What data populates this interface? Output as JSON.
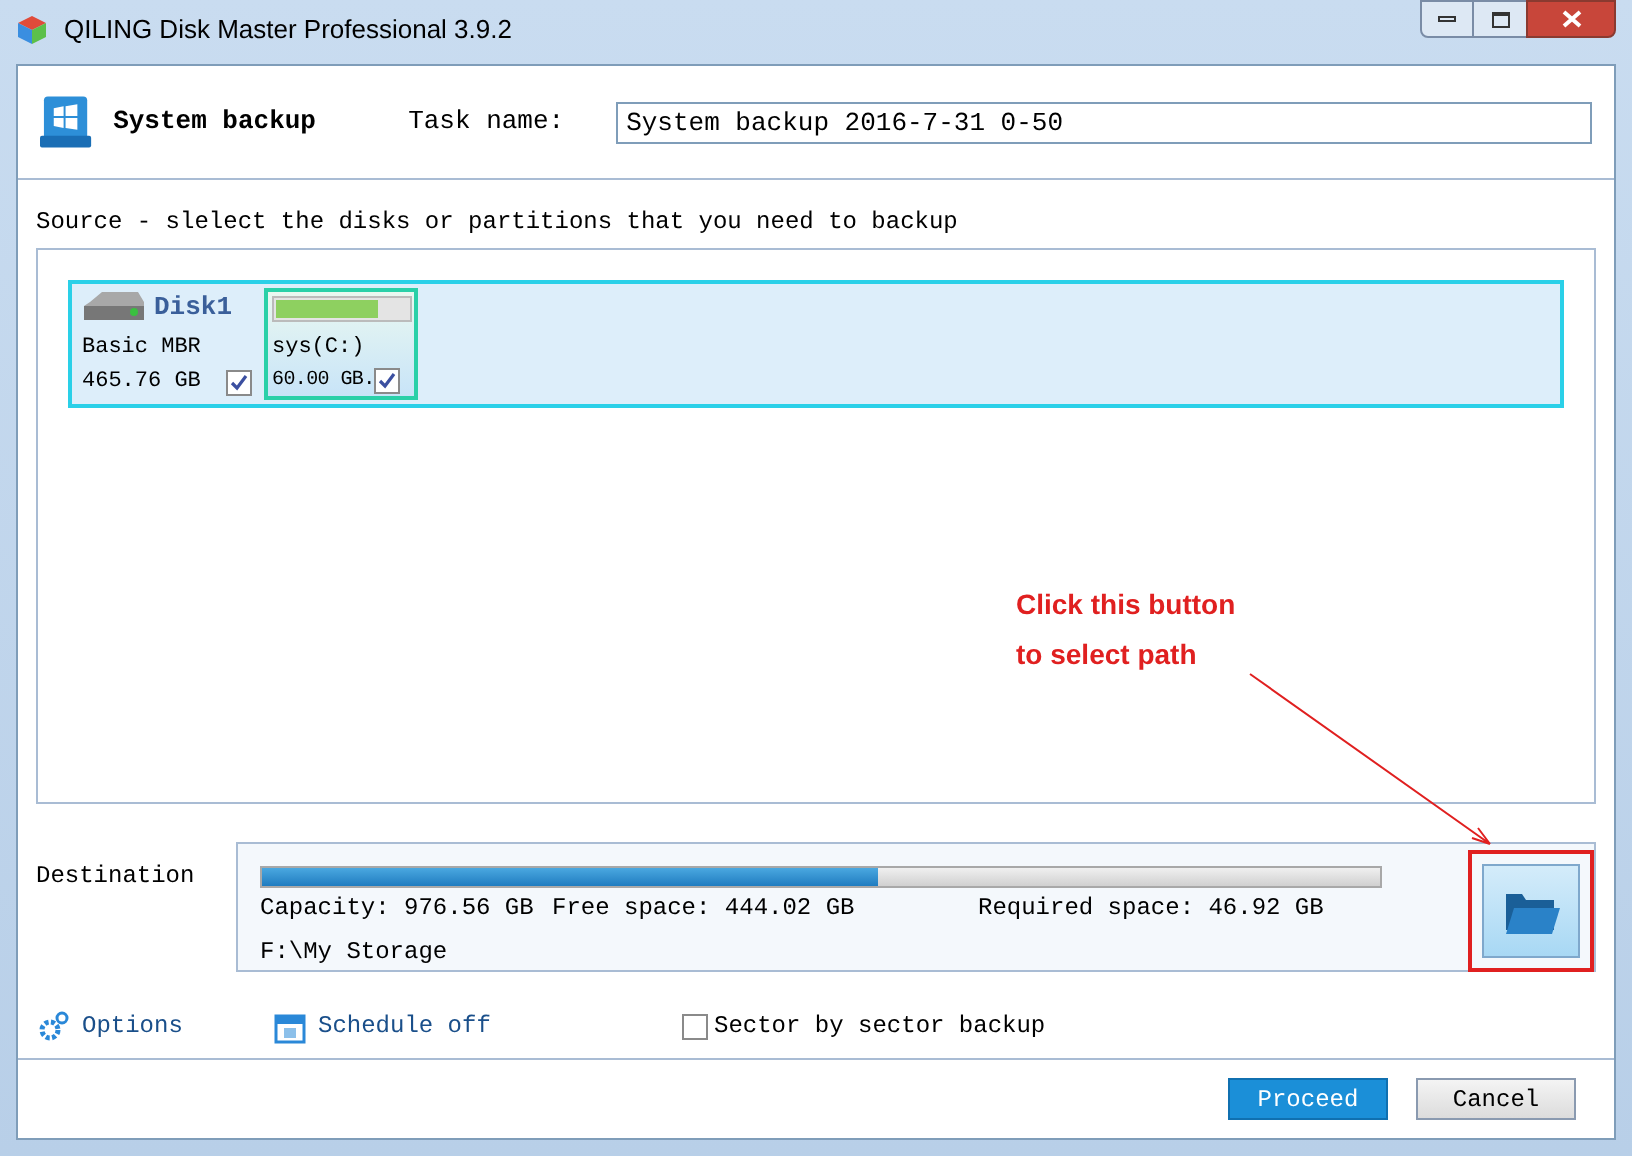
{
  "window": {
    "title": "QILING Disk Master Professional 3.9.2"
  },
  "header": {
    "title": "System backup",
    "task_label": "Task name:",
    "task_value": "System backup 2016-7-31 0-50"
  },
  "source": {
    "label": "Source - slelect the disks or partitions that you need to backup",
    "disks": [
      {
        "name": "Disk1",
        "type": "Basic MBR",
        "size": "465.76 GB",
        "checked": true,
        "selected": true,
        "partitions": [
          {
            "name": "sys(C:)",
            "size": "60.00 GB.",
            "checked": true,
            "level": 0.77
          }
        ]
      }
    ]
  },
  "destination": {
    "label": "Destination",
    "level": 0.55,
    "capacity": "Capacity: 976.56 GB",
    "free": "Free space: 444.02 GB",
    "required": "Required space: 46.92 GB",
    "path": "F:\\My Storage"
  },
  "annotation": {
    "lines": [
      "Click this button",
      "to select path"
    ]
  },
  "options": {
    "options_link": "Options",
    "schedule_link": "Schedule off",
    "sector": {
      "label": "Sector by sector backup",
      "checked": false
    }
  },
  "buttons": [
    {
      "label": "Proceed",
      "kind": "primary"
    },
    {
      "label": "Cancel",
      "kind": "secondary"
    }
  ]
}
